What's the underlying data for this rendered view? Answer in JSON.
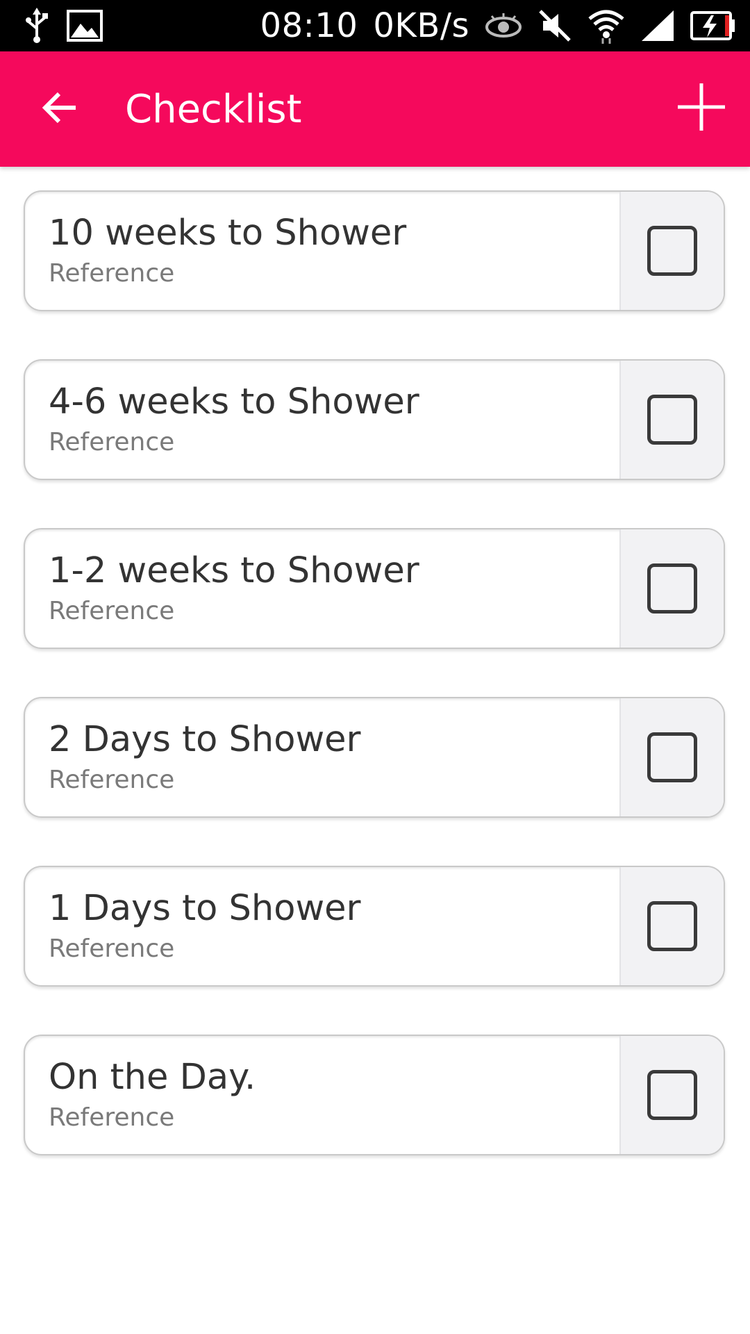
{
  "status_bar": {
    "time": "08:10",
    "net_speed": "0KB/s",
    "icons": [
      "usb-icon",
      "image-icon",
      "eye-icon",
      "mute-icon",
      "wifi-icon",
      "signal-icon",
      "battery-charging-icon"
    ]
  },
  "app_bar": {
    "title": "Checklist",
    "back_icon": "arrow-left-icon",
    "add_icon": "plus-icon",
    "color": "#f5095c"
  },
  "checklist": {
    "items": [
      {
        "title": "10 weeks to Shower",
        "subtitle": "Reference",
        "checked": false
      },
      {
        "title": "4-6 weeks to Shower",
        "subtitle": "Reference",
        "checked": false
      },
      {
        "title": "1-2 weeks to Shower",
        "subtitle": "Reference",
        "checked": false
      },
      {
        "title": "2 Days to Shower",
        "subtitle": "Reference",
        "checked": false
      },
      {
        "title": "1 Days to Shower",
        "subtitle": "Reference",
        "checked": false
      },
      {
        "title": "On the Day.",
        "subtitle": "Reference",
        "checked": false
      }
    ]
  }
}
